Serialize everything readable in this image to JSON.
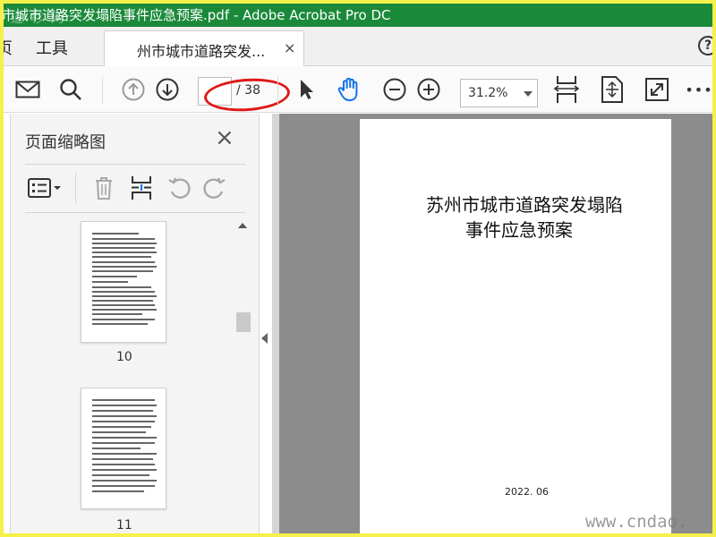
{
  "window": {
    "title": "市城市道路突发塌陷事件应急预案.pdf - Adobe Acrobat Pro DC",
    "watermark_top": "道  杉 网"
  },
  "tabs": {
    "home": "页",
    "tools": "工具",
    "document": "州市城市道路突发...",
    "close": "×",
    "help": "?"
  },
  "toolbar": {
    "current_page": "",
    "page_total": "/ 38",
    "zoom": "31.2%",
    "more": "•••"
  },
  "left_panel": {
    "title": "页面缩略图",
    "close": "×",
    "thumbnails": [
      {
        "label": "10"
      },
      {
        "label": "11"
      }
    ]
  },
  "document": {
    "title_line1": "苏州市城市道路突发塌陷",
    "title_line2": "事件应急预案",
    "date": "2022. 06"
  },
  "watermark_bottom": "www.cndao.",
  "colors": {
    "title_bar": "#1a8a3a",
    "accent_blue": "#1473e6",
    "annotation_red": "#e01818",
    "frame_yellow": "#f5f14a"
  }
}
